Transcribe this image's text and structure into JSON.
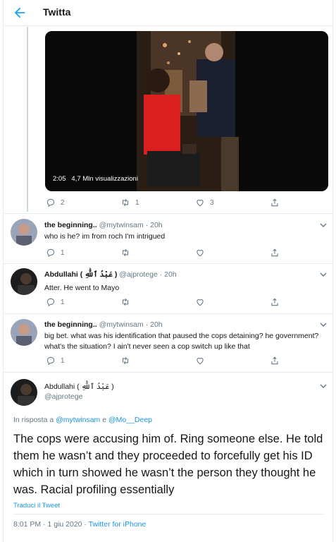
{
  "header": {
    "title": "Twitta"
  },
  "video": {
    "duration": "2:05",
    "views": "4,7 Mln visualizzazioni"
  },
  "top_actions": {
    "replies": "2",
    "retweets": "1",
    "likes": "3"
  },
  "replies": [
    {
      "name": "the beginning..",
      "handle": "@mytwinsam",
      "time": "· 20h",
      "text": "who is he? im from roch I'm intrigued",
      "replies": "1",
      "retweets": "",
      "likes": ""
    },
    {
      "name": "Abdullahi ( عَبْدُ ٱللَّٰهِ )",
      "handle": "@ajprotege",
      "time": "· 20h",
      "text": "Atter. He went to Mayo",
      "replies": "1",
      "retweets": "",
      "likes": ""
    },
    {
      "name": "the beginning..",
      "handle": "@mytwinsam",
      "time": "· 20h",
      "text": "big bet. what was his identification that paused the cops detaining? he government? what's the situation? I ain't never seen a cop switch up like that",
      "replies": "1",
      "retweets": "",
      "likes": ""
    }
  ],
  "main": {
    "name": "Abdullahi ( عَبْدُ ٱللَّٰهِ )",
    "handle": "@ajprotege",
    "reply_prefix": "In risposta a",
    "reply_user1": "@mytwinsam",
    "reply_and": "e",
    "reply_user2": "@Mo__Deep",
    "text": "The cops were accusing him of. Ring someone else. He told them he wasn’t and they proceeded to forcefully get his ID which in turn showed he wasn’t the person they thought he was. Racial profiling essentially",
    "translate": "Traduci il Tweet",
    "timestamp": "8:01 PM · 1 giu 2020 ·",
    "client": "Twitter for iPhone"
  },
  "colors": {
    "accent": "#1da1f2",
    "link": "#1b95e0",
    "muted": "#657786"
  }
}
